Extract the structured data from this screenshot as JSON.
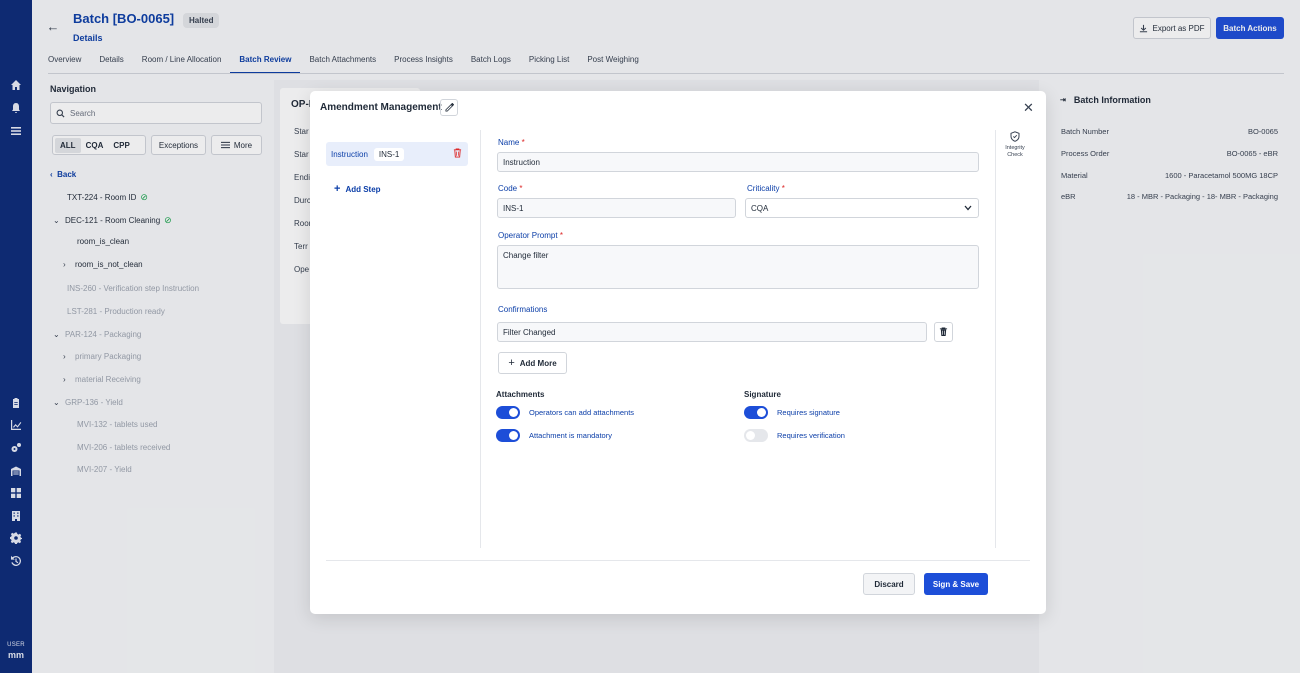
{
  "header": {
    "title": "Batch [BO-0065]",
    "status_badge": "Halted",
    "subtitle": "Details",
    "export_label": "Export as PDF",
    "actions_label": "Batch Actions"
  },
  "tabs": [
    {
      "label": "Overview"
    },
    {
      "label": "Details"
    },
    {
      "label": "Room / Line Allocation"
    },
    {
      "label": "Batch Review",
      "active": true
    },
    {
      "label": "Batch Attachments"
    },
    {
      "label": "Process Insights"
    },
    {
      "label": "Batch Logs"
    },
    {
      "label": "Picking List"
    },
    {
      "label": "Post Weighing"
    }
  ],
  "rail": {
    "top_icons": [
      "home-icon",
      "bell-icon",
      "list-icon"
    ],
    "bottom_icons": [
      "clipboard-icon",
      "chart-icon",
      "cogs-icon",
      "warehouse-icon",
      "grid-icon",
      "building-icon",
      "gear-icon",
      "history-icon"
    ],
    "user_label": "USER",
    "user_initials": "mm"
  },
  "navigation": {
    "title": "Navigation",
    "search_placeholder": "Search",
    "filters": [
      "ALL",
      "CQA",
      "CPP"
    ],
    "exceptions_label": "Exceptions",
    "more_label": "More",
    "back_label": "Back",
    "tree": [
      {
        "label": "TXT-224 - Room ID"
      },
      {
        "label": "DEC-121 - Room Cleaning"
      },
      {
        "label": "room_is_clean"
      },
      {
        "label": "room_is_not_clean"
      },
      {
        "label": "INS-260 - Verification step Instruction"
      },
      {
        "label": "LST-281 - Production ready"
      },
      {
        "label": "PAR-124 - Packaging"
      },
      {
        "label": "primary Packaging"
      },
      {
        "label": "material Receiving"
      },
      {
        "label": "GRP-136 - Yield"
      },
      {
        "label": "MVI-132 - tablets used"
      },
      {
        "label": "MVI-206 - tablets received"
      },
      {
        "label": "MVI-207 - Yield"
      }
    ]
  },
  "middle_card": {
    "title": "OP-I",
    "labels": [
      "Star",
      "Star",
      "Endi",
      "Durc",
      "Roor",
      "Terr",
      "Ope"
    ]
  },
  "batch_info": {
    "title": "Batch Information",
    "rows": [
      {
        "label": "Batch Number",
        "value": "BO-0065"
      },
      {
        "label": "Process Order",
        "value": "BO-0065 - eBR"
      },
      {
        "label": "Material",
        "value": "1600 - Paracetamol 500MG 18CP"
      },
      {
        "label": "eBR",
        "value": "18 - MBR - Packaging - 18- MBR - Packaging"
      }
    ]
  },
  "modal": {
    "title": "Amendment Management",
    "step": {
      "type": "Instruction",
      "code": "INS-1"
    },
    "add_step_label": "Add Step",
    "integrity_label_1": "Integrity",
    "integrity_label_2": "Check",
    "name_label": "Name",
    "name_value": "Instruction",
    "code_label": "Code",
    "code_value": "INS-1",
    "criticality_label": "Criticality",
    "criticality_value": "CQA",
    "prompt_label": "Operator Prompt",
    "prompt_value": "Change filter",
    "confirmations_label": "Confirmations",
    "confirmation_value": "Filter Changed",
    "add_more_label": "Add More",
    "attachments_title": "Attachments",
    "attach_toggle_1": "Operators can add attachments",
    "attach_toggle_2": "Attachment is mandatory",
    "signature_title": "Signature",
    "sig_toggle_1": "Requires signature",
    "sig_toggle_2": "Requires verification",
    "discard_label": "Discard",
    "save_label": "Sign & Save",
    "required_mark": "*"
  },
  "colors": {
    "primary": "#1d4ed8",
    "rail": "#0b2a78",
    "link": "#0b3ea8",
    "success": "#16a34a",
    "danger": "#dc2626"
  }
}
